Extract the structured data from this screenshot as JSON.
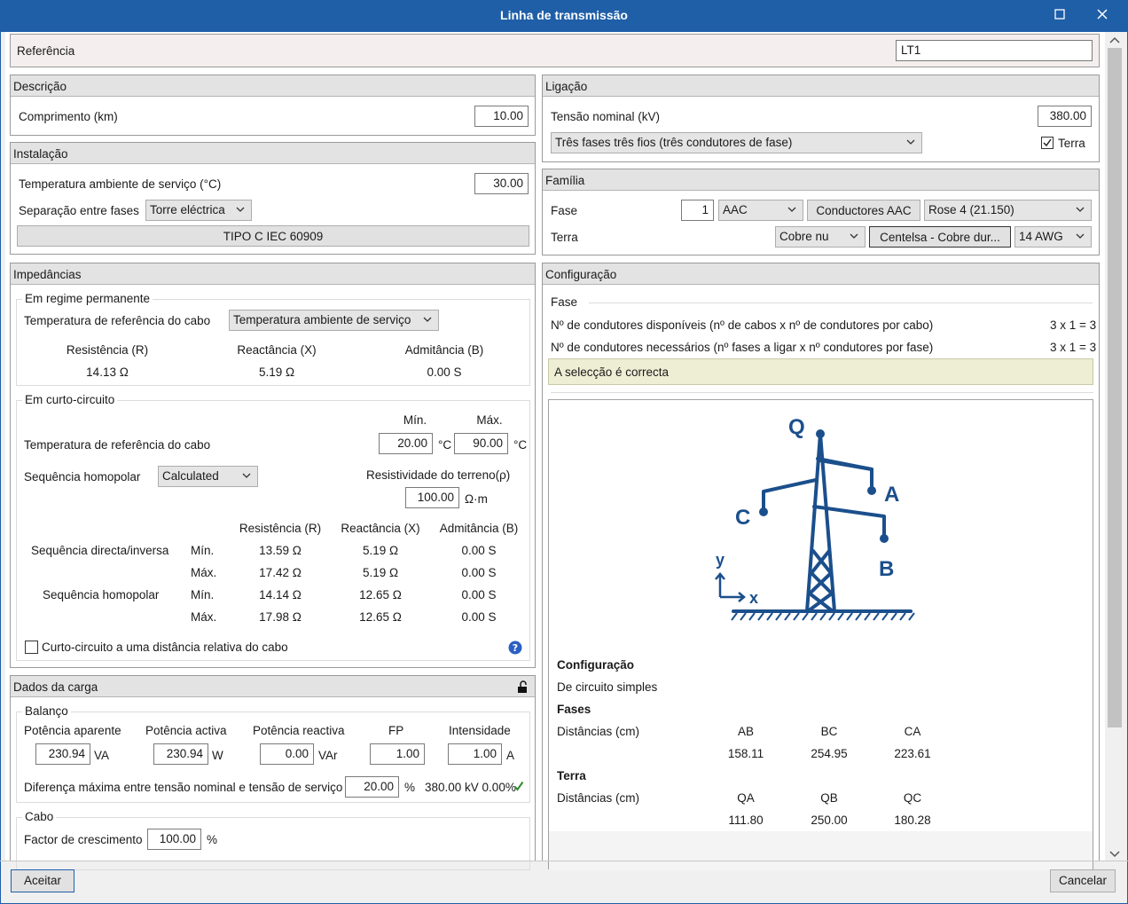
{
  "window": {
    "title": "Linha de transmissão"
  },
  "referencia": {
    "label": "Referência",
    "value": "LT1"
  },
  "descricao": {
    "title": "Descrição",
    "comprimento_label": "Comprimento (km)",
    "comprimento_value": "10.00"
  },
  "instalacao": {
    "title": "Instalação",
    "temp_label": "Temperatura ambiente de serviço (°C)",
    "temp_value": "30.00",
    "sep_label": "Separação entre fases",
    "sep_value": "Torre eléctrica",
    "tipo_button": "TIPO C IEC 60909"
  },
  "ligacao": {
    "title": "Ligação",
    "tensao_label": "Tensão nominal (kV)",
    "tensao_value": "380.00",
    "fases_value": "Três fases três fios (três condutores de fase)",
    "terra_label": "Terra"
  },
  "familia": {
    "title": "Família",
    "fase_label": "Fase",
    "fase_num": "1",
    "fase_material": "AAC",
    "fase_button": "Conductores AAC",
    "fase_conductor": "Rose 4 (21.150)",
    "terra_label": "Terra",
    "terra_material": "Cobre nu",
    "terra_button": "Centelsa - Cobre dur...",
    "terra_size": "14 AWG"
  },
  "impedancias": {
    "title": "Impedâncias",
    "permanente": {
      "title": "Em regime permanente",
      "temp_label": "Temperatura de referência do cabo",
      "temp_value": "Temperatura ambiente de serviço",
      "headers": [
        "Resistência (R)",
        "Reactância (X)",
        "Admitância (B)"
      ],
      "values": [
        "14.13 Ω",
        "5.19 Ω",
        "0.00 S"
      ]
    },
    "curto": {
      "title": "Em curto-circuito",
      "min_label": "Mín.",
      "max_label": "Máx.",
      "temp_label": "Temperatura de referência do cabo",
      "temp_min": "20.00",
      "temp_max": "90.00",
      "unit_c": "°C",
      "seq_label": "Sequência homopolar",
      "seq_value": "Calculated",
      "resist_label": "Resistividade do terreno(ρ)",
      "resist_value": "100.00",
      "resist_unit": "Ω·m",
      "headers": [
        "Resistência (R)",
        "Reactância (X)",
        "Admitância (B)"
      ],
      "rows": [
        {
          "group": "Sequência directa/inversa",
          "limit": "Mín.",
          "r": "13.59 Ω",
          "x": "5.19 Ω",
          "b": "0.00 S"
        },
        {
          "group": "",
          "limit": "Máx.",
          "r": "17.42 Ω",
          "x": "5.19 Ω",
          "b": "0.00 S"
        },
        {
          "group": "Sequência homopolar",
          "limit": "Mín.",
          "r": "14.14 Ω",
          "x": "12.65 Ω",
          "b": "0.00 S"
        },
        {
          "group": "",
          "limit": "Máx.",
          "r": "17.98 Ω",
          "x": "12.65 Ω",
          "b": "0.00 S"
        }
      ],
      "checkbox_label": "Curto-circuito a uma distância relativa do cabo"
    }
  },
  "carga": {
    "title": "Dados da carga",
    "balanco": {
      "title": "Balanço",
      "items": [
        {
          "label": "Potência aparente",
          "value": "230.94",
          "unit": "VA"
        },
        {
          "label": "Potência activa",
          "value": "230.94",
          "unit": "W"
        },
        {
          "label": "Potência reactiva",
          "value": "0.00",
          "unit": "VAr"
        },
        {
          "label": "FP",
          "value": "1.00",
          "unit": ""
        },
        {
          "label": "Intensidade",
          "value": "1.00",
          "unit": "A"
        }
      ],
      "dif_label": "Diferença máxima entre tensão nominal e tensão de serviço",
      "dif_value": "20.00",
      "dif_unit": "%",
      "dif_result": "380.00 kV 0.00%"
    },
    "cabo": {
      "title": "Cabo",
      "factor_label": "Factor de crescimento",
      "factor_value": "100.00",
      "factor_unit": "%"
    }
  },
  "configuracao": {
    "title": "Configuração",
    "fase_group": "Fase",
    "disp_label": "Nº de condutores disponíveis (nº de cabos x nº de condutores por cabo)",
    "disp_value": "3 x 1 = 3",
    "nec_label": "Nº de condutores necessários (nº fases a ligar x nº condutores por fase)",
    "nec_value": "3 x 1 = 3",
    "status": "A selecção é correcta",
    "diagram": {
      "q": "Q",
      "a": "A",
      "b": "B",
      "c": "C",
      "y": "y",
      "x": "x"
    },
    "info": {
      "config_title": "Configuração",
      "config_value": "De circuito simples",
      "fases_title": "Fases",
      "dist_label": "Distâncias (cm)",
      "fases_headers": [
        "AB",
        "BC",
        "CA"
      ],
      "fases_values": [
        "158.11",
        "254.95",
        "223.61"
      ],
      "terra_title": "Terra",
      "terra_dist_label": "Distâncias (cm)",
      "terra_headers": [
        "QA",
        "QB",
        "QC"
      ],
      "terra_values": [
        "111.80",
        "250.00",
        "180.28"
      ]
    }
  },
  "footer": {
    "accept": "Aceitar",
    "cancel": "Cancelar"
  },
  "colors": {
    "title_bar": "#1f5fa8",
    "diagram": "#1b4f8c",
    "status_bg": "#eeeed5",
    "check_green": "#2e8b2e"
  }
}
